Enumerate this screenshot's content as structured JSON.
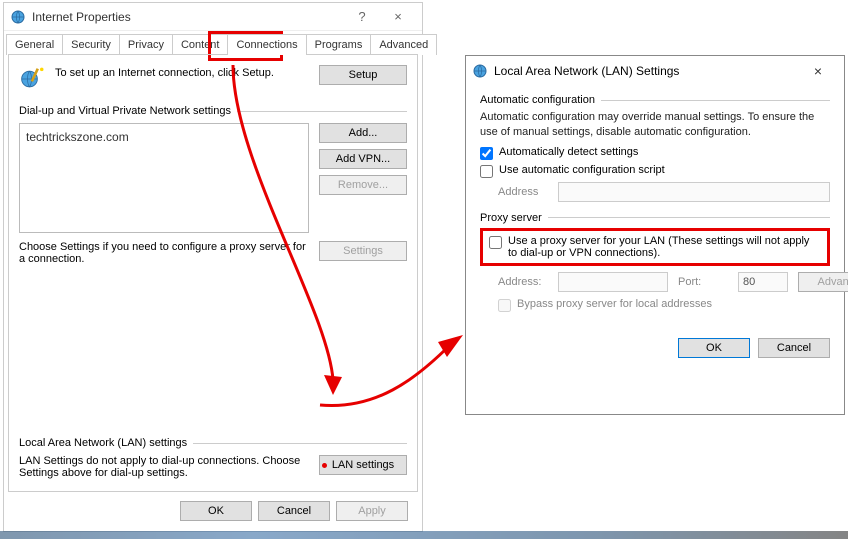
{
  "dialog1": {
    "title": "Internet Properties",
    "help": "?",
    "close": "×",
    "tabs": [
      "General",
      "Security",
      "Privacy",
      "Content",
      "Connections",
      "Programs",
      "Advanced"
    ],
    "activeTab": "Connections",
    "setupText": "To set up an Internet connection, click Setup.",
    "setupBtn": "Setup",
    "dialupSection": "Dial-up and Virtual Private Network settings",
    "listboxText": "techtrickszone.com",
    "addBtn": "Add...",
    "addVpnBtn": "Add VPN...",
    "removeBtn": "Remove...",
    "settingsBtn": "Settings",
    "chooseText": "Choose Settings if you need to configure a proxy server for a connection.",
    "lanSection": "Local Area Network (LAN) settings",
    "lanText": "LAN Settings do not apply to dial-up connections. Choose Settings above for dial-up settings.",
    "lanBtn": "LAN settings",
    "okBtn": "OK",
    "cancelBtn": "Cancel",
    "applyBtn": "Apply"
  },
  "dialog2": {
    "title": "Local Area Network (LAN) Settings",
    "close": "×",
    "autoGroup": "Automatic configuration",
    "autoDesc": "Automatic configuration may override manual settings.  To ensure the use of manual settings, disable automatic configuration.",
    "autoDetect": "Automatically detect settings",
    "autoScript": "Use automatic configuration script",
    "addressLabel": "Address",
    "proxyGroup": "Proxy server",
    "proxyUse": "Use a proxy server for your LAN (These settings will not apply to dial-up or VPN connections).",
    "address2Label": "Address:",
    "portLabel": "Port:",
    "portValue": "80",
    "advancedBtn": "Advanced",
    "bypass": "Bypass proxy server for local addresses",
    "okBtn": "OK",
    "cancelBtn": "Cancel"
  }
}
